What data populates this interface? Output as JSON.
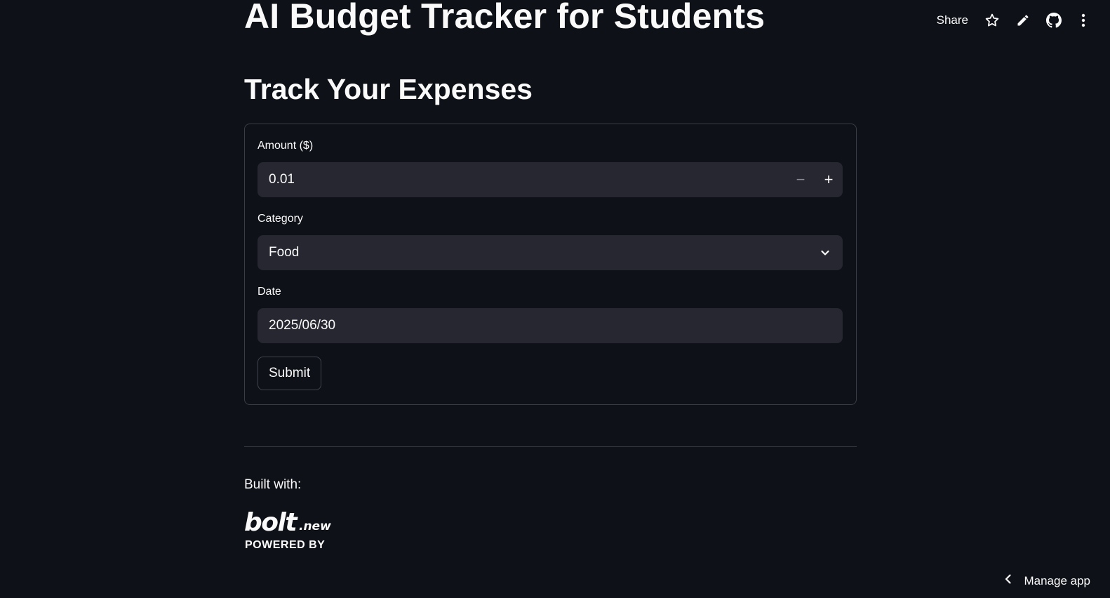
{
  "header": {
    "share_label": "Share",
    "icons": [
      "star-icon",
      "edit-icon",
      "github-icon",
      "more-vertical-icon"
    ]
  },
  "page": {
    "title": "AI Budget Tracker for Students",
    "section_title": "Track Your Expenses"
  },
  "form": {
    "amount": {
      "label": "Amount ($)",
      "value": "0.01",
      "decrement_symbol": "−",
      "increment_symbol": "+"
    },
    "category": {
      "label": "Category",
      "selected": "Food"
    },
    "date": {
      "label": "Date",
      "value": "2025/06/30"
    },
    "submit_label": "Submit"
  },
  "footer": {
    "built_with_label": "Built with:",
    "logo": {
      "wordmark": "bolt",
      "suffix": ".new",
      "tagline": "POWERED BY"
    },
    "manage_app_label": "Manage app"
  },
  "colors": {
    "background": "#0e1117",
    "field_background": "#262730",
    "text": "#fafafa",
    "border": "#3a3d48"
  }
}
